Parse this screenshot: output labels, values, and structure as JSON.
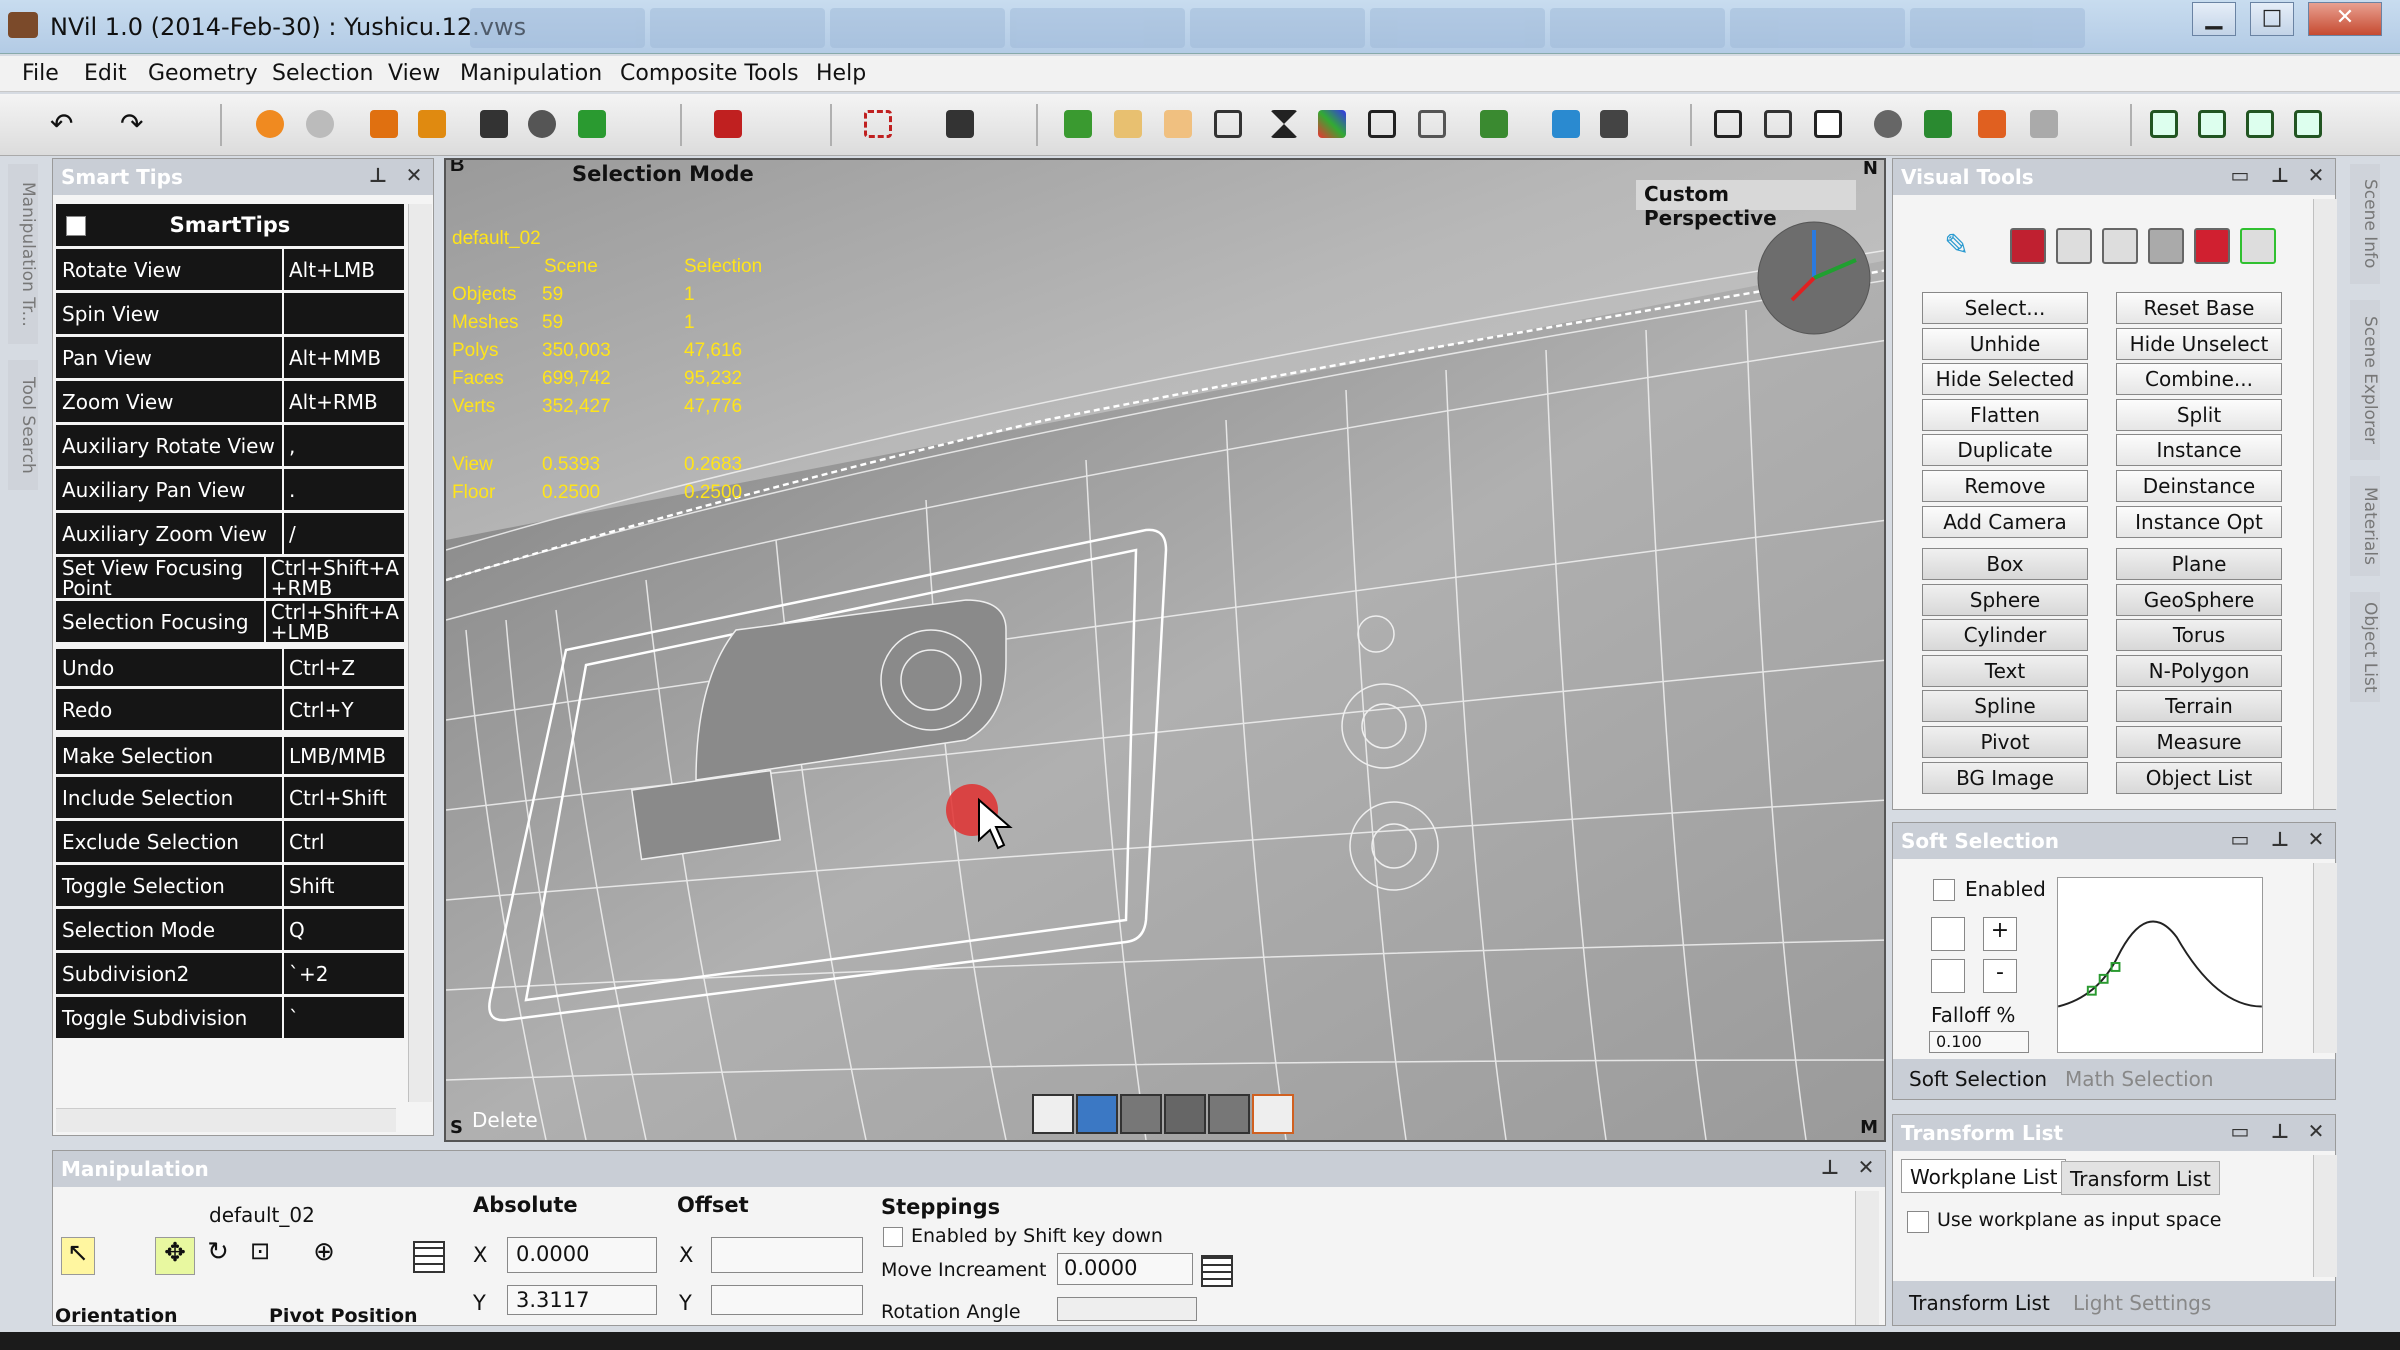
{
  "window": {
    "title": "NVil 1.0 (2014-Feb-30) : Yushicu.12.vws",
    "minimize": "▁",
    "maximize": "□",
    "close": "✕"
  },
  "menu": [
    "File",
    "Edit",
    "Geometry",
    "Selection",
    "View",
    "Manipulation",
    "Composite Tools",
    "Help"
  ],
  "smart_tips": {
    "title": "Smart Tips",
    "header": "SmartTips",
    "rows": [
      {
        "action": "Rotate View",
        "key": "Alt+LMB"
      },
      {
        "action": "Spin View",
        "key": ""
      },
      {
        "action": "Pan View",
        "key": "Alt+MMB"
      },
      {
        "action": "Zoom View",
        "key": "Alt+RMB"
      },
      {
        "action": "Auxiliary Rotate View",
        "key": ","
      },
      {
        "action": "Auxiliary Pan View",
        "key": "."
      },
      {
        "action": "Auxiliary Zoom View",
        "key": "/"
      },
      {
        "action": "Set View Focusing Point",
        "key": "Ctrl+Shift+A +RMB"
      },
      {
        "action": "Selection Focusing",
        "key": "Ctrl+Shift+A +LMB"
      },
      {
        "action": "Undo",
        "key": "Ctrl+Z"
      },
      {
        "action": "Redo",
        "key": "Ctrl+Y"
      },
      {
        "action": "Make Selection",
        "key": "LMB/MMB"
      },
      {
        "action": "Include Selection",
        "key": "Ctrl+Shift"
      },
      {
        "action": "Exclude Selection",
        "key": "Ctrl"
      },
      {
        "action": "Toggle Selection",
        "key": "Shift"
      },
      {
        "action": "Selection Mode",
        "key": "Q"
      },
      {
        "action": "Subdivision2",
        "key": "`+2"
      },
      {
        "action": "Toggle Subdivision",
        "key": "`"
      }
    ]
  },
  "viewport": {
    "mode_label": "Selection Mode",
    "camera_label": "Custom Perspective",
    "corner_b": "B",
    "corner_n": "N",
    "corner_s": "S",
    "corner_m": "M",
    "status_text": "Delete",
    "stats": {
      "object_name": "default_02",
      "col_scene": "Scene",
      "col_selection": "Selection",
      "rows": [
        {
          "label": "Objects",
          "scene": "59",
          "selection": "1"
        },
        {
          "label": "Meshes",
          "scene": "59",
          "selection": "1"
        },
        {
          "label": "Polys",
          "scene": "350,003",
          "selection": "47,616"
        },
        {
          "label": "Faces",
          "scene": "699,742",
          "selection": "95,232"
        },
        {
          "label": "Verts",
          "scene": "352,427",
          "selection": "47,776"
        }
      ],
      "view_label": "View",
      "view_value": "0.5393",
      "view_value2": "0.2683",
      "floor_label": "Floor",
      "floor_value": "0.2500",
      "floor_value2": "0.2500"
    }
  },
  "visual_tools": {
    "title": "Visual Tools",
    "buttons_left": [
      "Select...",
      "Unhide",
      "Hide Selected",
      "Flatten",
      "Duplicate",
      "Remove",
      "Add Camera"
    ],
    "buttons_right": [
      "Reset Base",
      "Hide Unselect",
      "Combine...",
      "Split",
      "Instance",
      "Deinstance",
      "Instance Opt"
    ],
    "prims_left": [
      "Box",
      "Sphere",
      "Cylinder",
      "Text",
      "Spline",
      "Pivot",
      "BG Image"
    ],
    "prims_right": [
      "Plane",
      "GeoSphere",
      "Torus",
      "N-Polygon",
      "Terrain",
      "Measure",
      "Object List"
    ]
  },
  "soft_selection": {
    "title": "Soft Selection",
    "enabled_label": "Enabled",
    "falloff_label": "Falloff %",
    "falloff_value": "0.100",
    "plus": "+",
    "minus": "-",
    "tab_soft": "Soft Selection",
    "tab_math": "Math Selection"
  },
  "transform_list": {
    "title": "Transform List",
    "tab_workplane": "Workplane List",
    "tab_transform": "Transform List",
    "use_workplane": "Use workplane as input space",
    "bottom_tab1": "Transform List",
    "bottom_tab2": "Light Settings"
  },
  "manipulation": {
    "title": "Manipulation",
    "object_name": "default_02",
    "absolute": "Absolute",
    "offset": "Offset",
    "x_label": "X",
    "y_label": "Y",
    "abs_x": "0.0000",
    "abs_y": "3.3117",
    "steppings": "Steppings",
    "shift_label": "Enabled by Shift key down",
    "move_inc_label": "Move Increament",
    "move_inc_value": "0.0000",
    "rotation_label": "Rotation Angle",
    "orientation": "Orientation",
    "pivot_position": "Pivot Position"
  },
  "side_tabs": {
    "left": [
      "Manipulation Tr...",
      "Tool Search"
    ],
    "right": [
      "Scene Info",
      "Scene Explorer",
      "Materials",
      "Object List"
    ]
  }
}
